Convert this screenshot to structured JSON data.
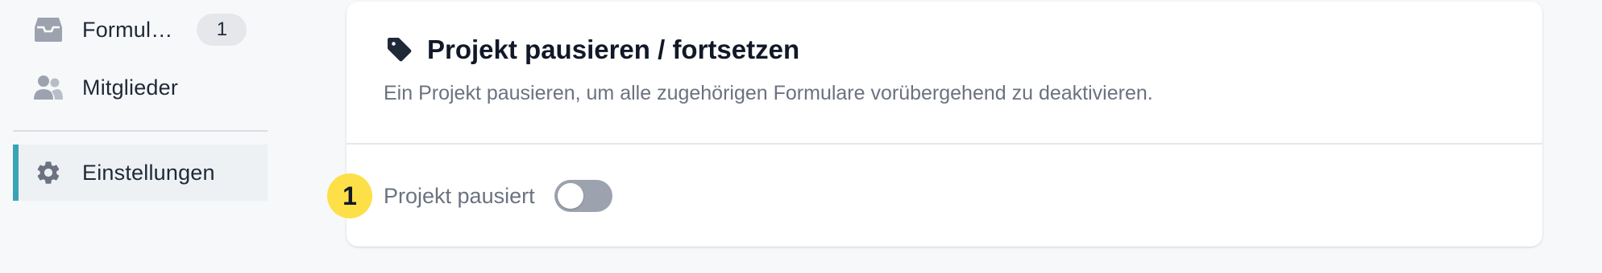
{
  "sidebar": {
    "items": [
      {
        "label": "Formul…",
        "icon": "inbox-icon",
        "badge": "1"
      },
      {
        "label": "Mitglieder",
        "icon": "users-icon"
      },
      {
        "label": "Einstellungen",
        "icon": "gear-icon",
        "active": true
      }
    ]
  },
  "card": {
    "title": "Projekt pausieren / fortsetzen",
    "title_icon": "tag-icon",
    "description": "Ein Projekt pausieren, um alle zugehörigen Formulare vorübergehend zu deaktivieren.",
    "toggle": {
      "label": "Projekt pausiert",
      "checked": false
    }
  },
  "annotation": {
    "marker": "1"
  },
  "colors": {
    "accent": "#3aa3b4",
    "marker": "#fde047",
    "toggle_off": "#9ca3af",
    "active_bg": "#edf1f4"
  }
}
